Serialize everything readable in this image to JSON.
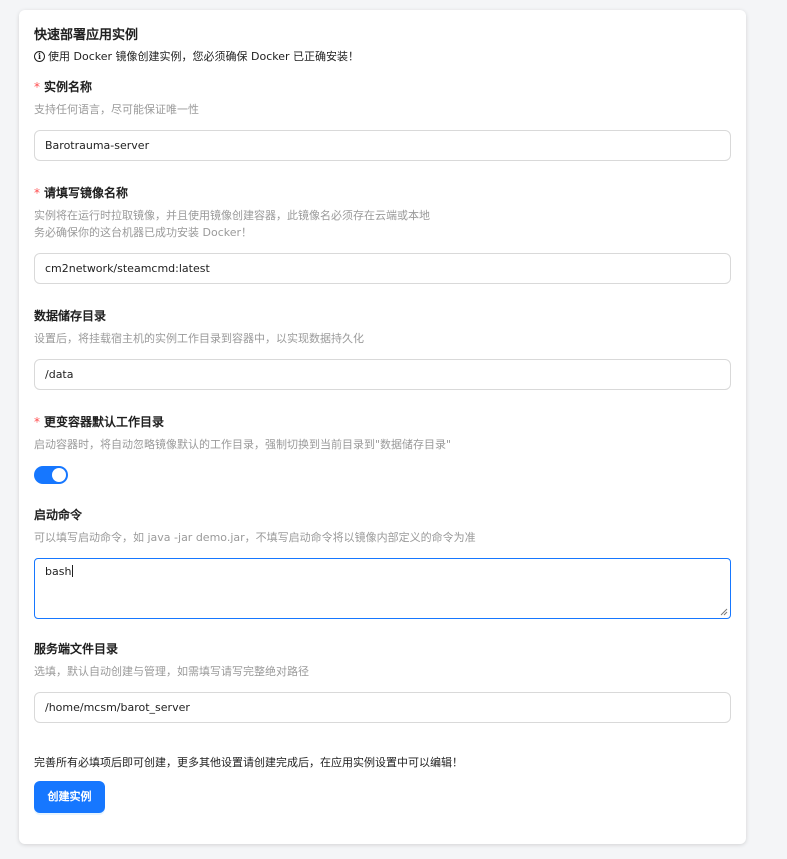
{
  "form": {
    "title": "快速部署应用实例",
    "warning": "使用 Docker 镜像创建实例，您必须确保 Docker 已正确安装！",
    "required_mark": "*",
    "instance_name": {
      "label": "实例名称",
      "desc": "支持任何语言，尽可能保证唯一性",
      "value": "Barotrauma-server"
    },
    "image_name": {
      "label": "请填写镜像名称",
      "desc_line1": "实例将在运行时拉取镜像，并且使用镜像创建容器，此镜像名必须存在云端或本地",
      "desc_line2": "务必确保你的这台机器已成功安装 Docker！",
      "value": "cm2network/steamcmd:latest"
    },
    "data_dir": {
      "label": "数据储存目录",
      "desc": "设置后，将挂载宿主机的实例工作目录到容器中，以实现数据持久化",
      "value": "/data"
    },
    "change_workdir": {
      "label": "更变容器默认工作目录",
      "desc": "启动容器时，将自动忽略镜像默认的工作目录，强制切换到当前目录到\"数据储存目录\"",
      "enabled": true
    },
    "start_command": {
      "label": "启动命令",
      "desc": "可以填写启动命令，如 java -jar demo.jar，不填写启动命令将以镜像内部定义的命令为准",
      "value": "bash"
    },
    "server_dir": {
      "label": "服务端文件目录",
      "desc": "选填，默认自动创建与管理，如需填写请写完整绝对路径",
      "value": "/home/mcsm/barot_server"
    },
    "footer_note": "完善所有必填项后即可创建，更多其他设置请创建完成后，在应用实例设置中可以编辑！",
    "submit_label": "创建实例"
  },
  "colors": {
    "primary": "#1677ff",
    "required": "#ff4d4f",
    "muted_text": "#9a9a9a"
  }
}
